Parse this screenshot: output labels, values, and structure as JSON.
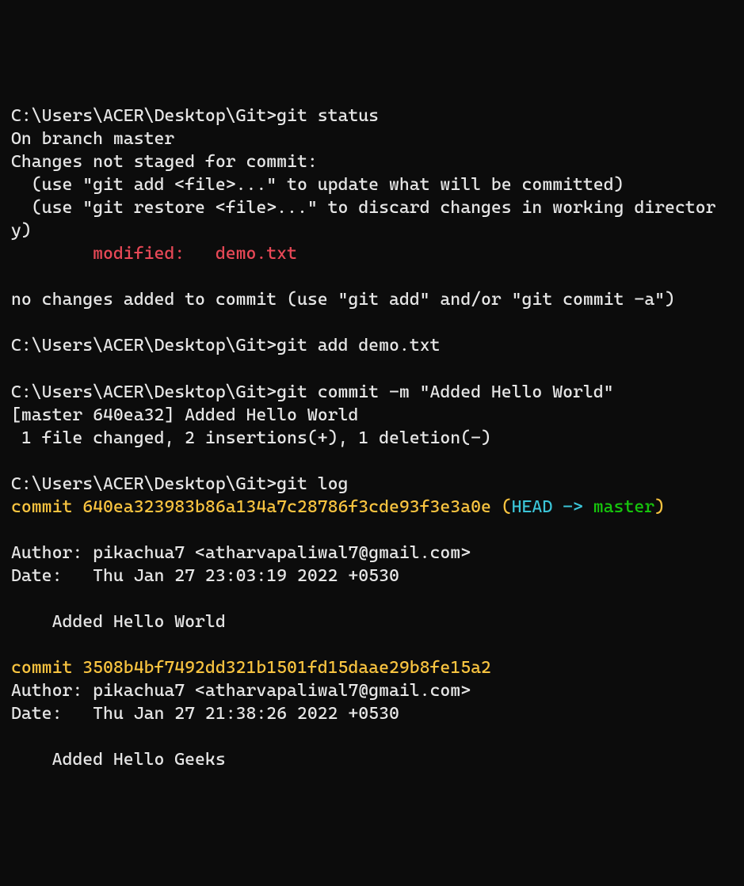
{
  "prompt": "C:\\Users\\ACER\\Desktop\\Git>",
  "cmd_status": "git status",
  "status_branch": "On branch master",
  "status_notstaged": "Changes not staged for commit:",
  "status_hint1": "  (use \"git add <file>...\" to update what will be committed)",
  "status_hint2": "  (use \"git restore <file>...\" to discard changes in working directory)",
  "status_modified": "        modified:   demo.txt",
  "status_nochanges": "no changes added to commit (use \"git add\" and/or \"git commit -a\")",
  "cmd_add": "git add demo.txt",
  "cmd_commit": "git commit -m \"Added Hello World\"",
  "commit_out1": "[master 640ea32] Added Hello World",
  "commit_out2": " 1 file changed, 2 insertions(+), 1 deletion(-)",
  "cmd_log": "git log",
  "log1_commit_prefix": "commit ",
  "log1_hash": "640ea323983b86a134a7c28786f3cde93f3e3a0e",
  "log1_ref_open": " (",
  "log1_head": "HEAD -> ",
  "log1_master": "master",
  "log1_ref_close": ")",
  "log1_author": "Author: pikachua7 <atharvapaliwal7@gmail.com>",
  "log1_date": "Date:   Thu Jan 27 23:03:19 2022 +0530",
  "log1_msg": "    Added Hello World",
  "log2_commit_prefix": "commit ",
  "log2_hash": "3508b4bf7492dd321b1501fd15daae29b8fe15a2",
  "log2_author": "Author: pikachua7 <atharvapaliwal7@gmail.com>",
  "log2_date": "Date:   Thu Jan 27 21:38:26 2022 +0530",
  "log2_msg": "    Added Hello Geeks"
}
